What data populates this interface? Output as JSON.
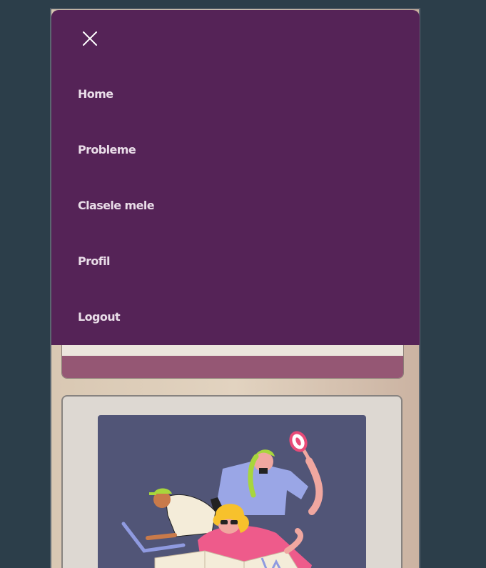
{
  "menu": {
    "close_icon": "close-icon",
    "items": [
      {
        "label": "Home"
      },
      {
        "label": "Probleme"
      },
      {
        "label": "Clasele mele"
      },
      {
        "label": "Profil"
      },
      {
        "label": "Logout"
      }
    ]
  },
  "illustration": {
    "icon": "people-with-map-and-magnifier-illustration"
  },
  "colors": {
    "page_background": "#2c3e4a",
    "menu_background": "#552357",
    "menu_text": "#e9dde8",
    "card_band": "#955774",
    "illustration_background": "#515577"
  }
}
